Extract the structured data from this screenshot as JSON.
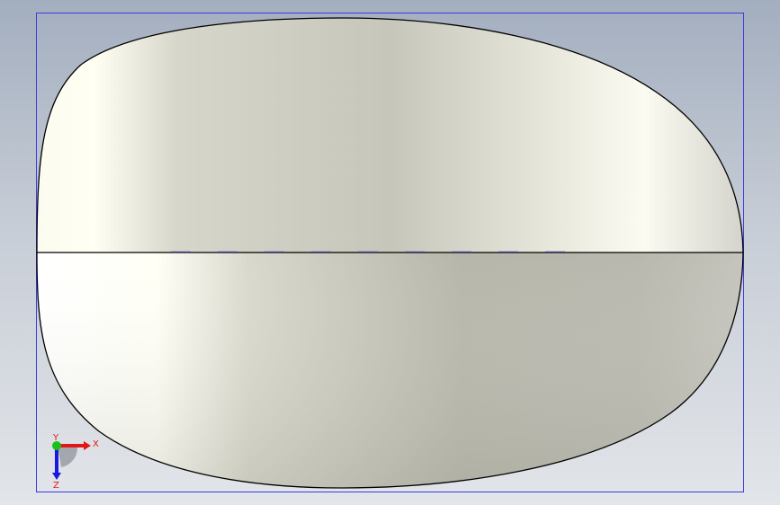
{
  "viewport": {
    "background_top": "#a3aebf",
    "background_bottom": "#e2e5e9",
    "bounding_box_color": "#3a3ae0",
    "silhouette_color": "#000000",
    "parting_line_color": "#000000"
  },
  "model": {
    "shape": "egg-shaped lens",
    "face_highlight": "#fffff2",
    "face_base": "#c8c8bc",
    "face_shadow": "#a8a89c"
  },
  "triad": {
    "x_label": "X",
    "y_label": "Y",
    "z_label": "Z",
    "x_color": "#e01818",
    "y_color": "#18c018",
    "z_color": "#1818e0"
  }
}
